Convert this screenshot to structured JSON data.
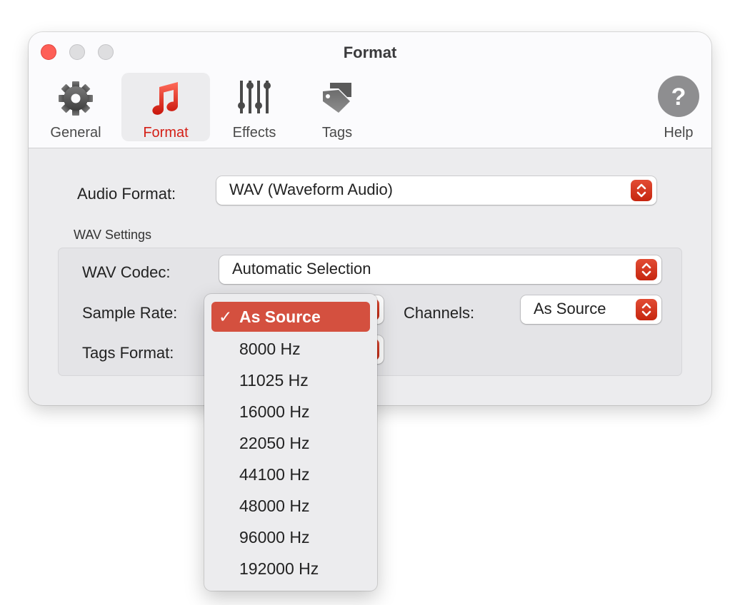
{
  "window": {
    "title": "Format"
  },
  "toolbar": {
    "items": [
      {
        "label": "General",
        "icon": "gear-icon"
      },
      {
        "label": "Format",
        "icon": "music-note-icon",
        "active": true
      },
      {
        "label": "Effects",
        "icon": "sliders-icon"
      },
      {
        "label": "Tags",
        "icon": "tag-icon"
      }
    ],
    "help": {
      "label": "Help",
      "icon": "help-icon"
    }
  },
  "audio_format": {
    "label": "Audio Format:",
    "value": "WAV (Waveform Audio)"
  },
  "wav_settings": {
    "title": "WAV Settings",
    "codec": {
      "label": "WAV Codec:",
      "value": "Automatic Selection"
    },
    "sample_rate": {
      "label": "Sample Rate:",
      "value": "As Source"
    },
    "channels": {
      "label": "Channels:",
      "value": "As Source"
    },
    "tags_format": {
      "label": "Tags Format:",
      "value": ""
    }
  },
  "sample_rate_menu": {
    "check_glyph": "✓",
    "options": [
      {
        "label": "As Source",
        "selected": true
      },
      {
        "label": "8000 Hz"
      },
      {
        "label": "11025 Hz"
      },
      {
        "label": "16000 Hz"
      },
      {
        "label": "22050 Hz"
      },
      {
        "label": "44100 Hz"
      },
      {
        "label": "48000 Hz"
      },
      {
        "label": "96000 Hz"
      },
      {
        "label": "192000 Hz"
      }
    ]
  },
  "colors": {
    "accent": "#d4503f",
    "accent_text": "#d41f16",
    "close_button": "#fe5f57"
  }
}
